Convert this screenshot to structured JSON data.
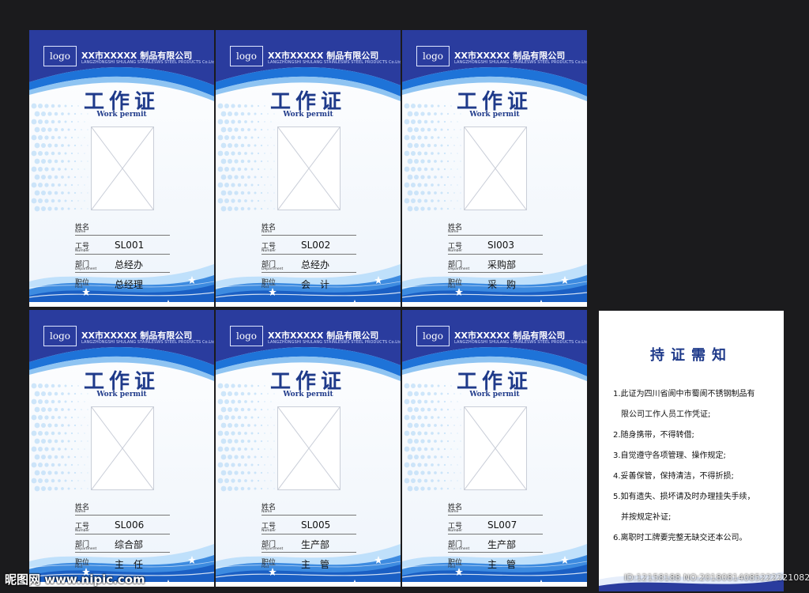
{
  "colors": {
    "navy": "#1f3a8a",
    "header_blue": "#2a3c9e",
    "wave_blue": "#1e73d8",
    "light_blue": "#cfe6fb"
  },
  "card_common": {
    "logo": "logo",
    "company_cn": "XX市XXXXX 制品有限公司",
    "company_en": "LANGZHONGSHI SHULANG STAINLESWS STEEL PRODUCTS Co.Ltd",
    "title": "工作证",
    "subtitle": "Work permit",
    "label_name": "姓名",
    "label_name_en": "Name",
    "label_number": "工号",
    "label_number_en": "Number",
    "label_dept": "部门",
    "label_dept_en": "Department",
    "label_post": "职位",
    "label_post_en": "Post"
  },
  "cards": [
    {
      "number": "SL001",
      "department": "总经办",
      "post": "总经理"
    },
    {
      "number": "SL002",
      "department": "总经办",
      "post": "会　计"
    },
    {
      "number": "SI003",
      "department": "采购部",
      "post": "采　购"
    },
    {
      "number": "SL006",
      "department": "综合部",
      "post": "主　任"
    },
    {
      "number": "SL005",
      "department": "生产部",
      "post": "主　管"
    },
    {
      "number": "SL007",
      "department": "生产部",
      "post": "主　管"
    }
  ],
  "notice": {
    "title": "持证需知",
    "lines": [
      "1.此证为四川省阆中市蜀阆不锈钢制品有",
      "限公司工作人员工作凭证;",
      "2.随身携带，不得转借;",
      "3.自觉遵守各项管理、操作规定;",
      "4.妥善保管，保持清洁，不得折损;",
      "5.如有遗失、损坏请及时办理挂失手续，",
      "并按规定补证;",
      "6.离职时工牌要完整无缺交还本公司。"
    ]
  },
  "watermark": {
    "site": "昵图网 www.nipic.com",
    "id": "ID:12158188 NO:20180814085222221082"
  }
}
